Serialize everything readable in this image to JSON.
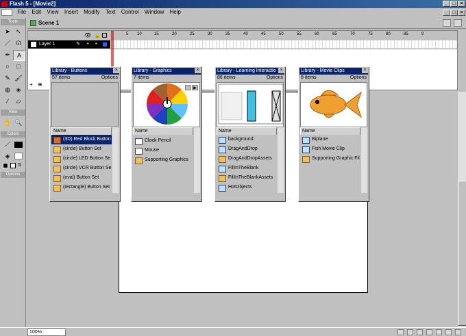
{
  "window": {
    "title": "Flash 5 - [Movie2]"
  },
  "menu": [
    "File",
    "Edit",
    "View",
    "Insert",
    "Modify",
    "Text",
    "Control",
    "Window",
    "Help"
  ],
  "tools": {
    "section_tools": "Tools",
    "section_view": "View",
    "section_colors": "Colors",
    "section_options": "Options"
  },
  "scene": {
    "label": "Scene 1"
  },
  "timeline": {
    "frame_numbers": [
      "5",
      "10",
      "15",
      "20",
      "25",
      "30",
      "35",
      "40",
      "45",
      "50",
      "55",
      "60",
      "65",
      "70",
      "75",
      "80",
      "85",
      "9"
    ],
    "layer_name": "Layer 1"
  },
  "status": {
    "zoom": "100%"
  },
  "libraries": [
    {
      "title": "Library - Buttons",
      "count": "57 items",
      "options": "Options",
      "column": "Name",
      "items": [
        {
          "label": "(3D) Red Block Button",
          "type": "btn",
          "selected": true
        },
        {
          "label": "(circle) Button Set",
          "type": "fold"
        },
        {
          "label": "(circle) LED Button Se",
          "type": "fold"
        },
        {
          "label": "(circle) VCR Button Se",
          "type": "fold"
        },
        {
          "label": "(oval) Button Set",
          "type": "fold"
        },
        {
          "label": "(rectangle) Button Set",
          "type": "fold"
        }
      ]
    },
    {
      "title": "Library - Graphics",
      "count": "7 items",
      "options": "",
      "column": "Name",
      "items": [
        {
          "label": "Clock Pencil",
          "type": "gfx"
        },
        {
          "label": "Mouse",
          "type": "gfx"
        },
        {
          "label": "Supporting Graphics",
          "type": "fold"
        }
      ]
    },
    {
      "title": "Library - Learning Interactio",
      "count": "86 items",
      "options": "Options",
      "column": "Name",
      "items": [
        {
          "label": "background",
          "type": "mc"
        },
        {
          "label": "DragAndDrop",
          "type": "mc"
        },
        {
          "label": "DragAndDropAssets",
          "type": "fold"
        },
        {
          "label": "FillInTheBlank",
          "type": "mc"
        },
        {
          "label": "FillInTheBlankAssets",
          "type": "fold"
        },
        {
          "label": "HotObjects",
          "type": "mc"
        }
      ]
    },
    {
      "title": "Library - Movie Clips",
      "count": "8 items",
      "options": "Options",
      "column": "Name",
      "items": [
        {
          "label": "Biplane",
          "type": "mc"
        },
        {
          "label": "Fish Movie Clip",
          "type": "mc"
        },
        {
          "label": "Supporting Graphic Fil",
          "type": "fold"
        }
      ]
    }
  ]
}
